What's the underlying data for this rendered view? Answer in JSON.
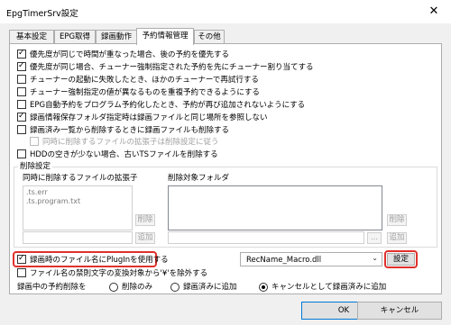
{
  "window": {
    "title": "EpgTimerSrv設定",
    "close_glyph": "✕"
  },
  "tabs": [
    {
      "label": "基本設定",
      "active": false
    },
    {
      "label": "EPG取得",
      "active": false
    },
    {
      "label": "録画動作",
      "active": false
    },
    {
      "label": "予約情報管理",
      "active": true
    },
    {
      "label": "その他",
      "active": false
    }
  ],
  "options": [
    {
      "label": "優先度が同じで時間が重なった場合、後の予約を優先する",
      "checked": true,
      "disabled": false
    },
    {
      "label": "優先度が同じ場合、チューナー強制指定された予約を先にチューナー割り当てする",
      "checked": true,
      "disabled": false
    },
    {
      "label": "チューナーの起動に失敗したとき、ほかのチューナーで再試行する",
      "checked": false,
      "disabled": false
    },
    {
      "label": "チューナー強制指定の値が異なるものを重複予約できるようにする",
      "checked": false,
      "disabled": false
    },
    {
      "label": "EPG自動予約をプログラム予約化したとき、予約が再び追加されないようにする",
      "checked": false,
      "disabled": false
    },
    {
      "label": "録画情報保存フォルダ指定時は録画ファイルと同じ場所を参照しない",
      "checked": true,
      "disabled": false
    },
    {
      "label": "録画済み一覧から削除するときに録画ファイルも削除する",
      "checked": false,
      "disabled": false
    },
    {
      "label": "同時に削除するファイルの拡張子は削除設定に従う",
      "checked": false,
      "disabled": true
    },
    {
      "label": "HDDの空きが少ない場合、古いTSファイルを削除する",
      "checked": false,
      "disabled": false
    }
  ],
  "delete_settings": {
    "group_label": "削除設定",
    "extensions_label": "同時に削除するファイルの拡張子",
    "folders_label": "削除対象フォルダ",
    "extensions": [
      ".ts.err",
      ".ts.program.txt"
    ],
    "delete_button": "削除",
    "add_button": "追加",
    "browse_button": "..."
  },
  "plugin": {
    "label": "録画時のファイル名にPlugInを使用する",
    "checked": true,
    "selected": "RecName_Macro.dll",
    "settings_button": "設定"
  },
  "forbidden_chars": {
    "label": "ファイル名の禁則文字の変換対象から'¥'を除外する",
    "checked": false
  },
  "recording_delete": {
    "label": "録画中の予約削除を",
    "options": [
      {
        "label": "削除のみ",
        "checked": false
      },
      {
        "label": "録画済みに追加",
        "checked": false
      },
      {
        "label": "キャンセルとして録画済みに追加",
        "checked": true
      }
    ]
  },
  "footer": {
    "ok": "OK",
    "cancel": "キャンセル"
  },
  "colors": {
    "highlight": "#e0302a",
    "accent": "#0078d7"
  }
}
